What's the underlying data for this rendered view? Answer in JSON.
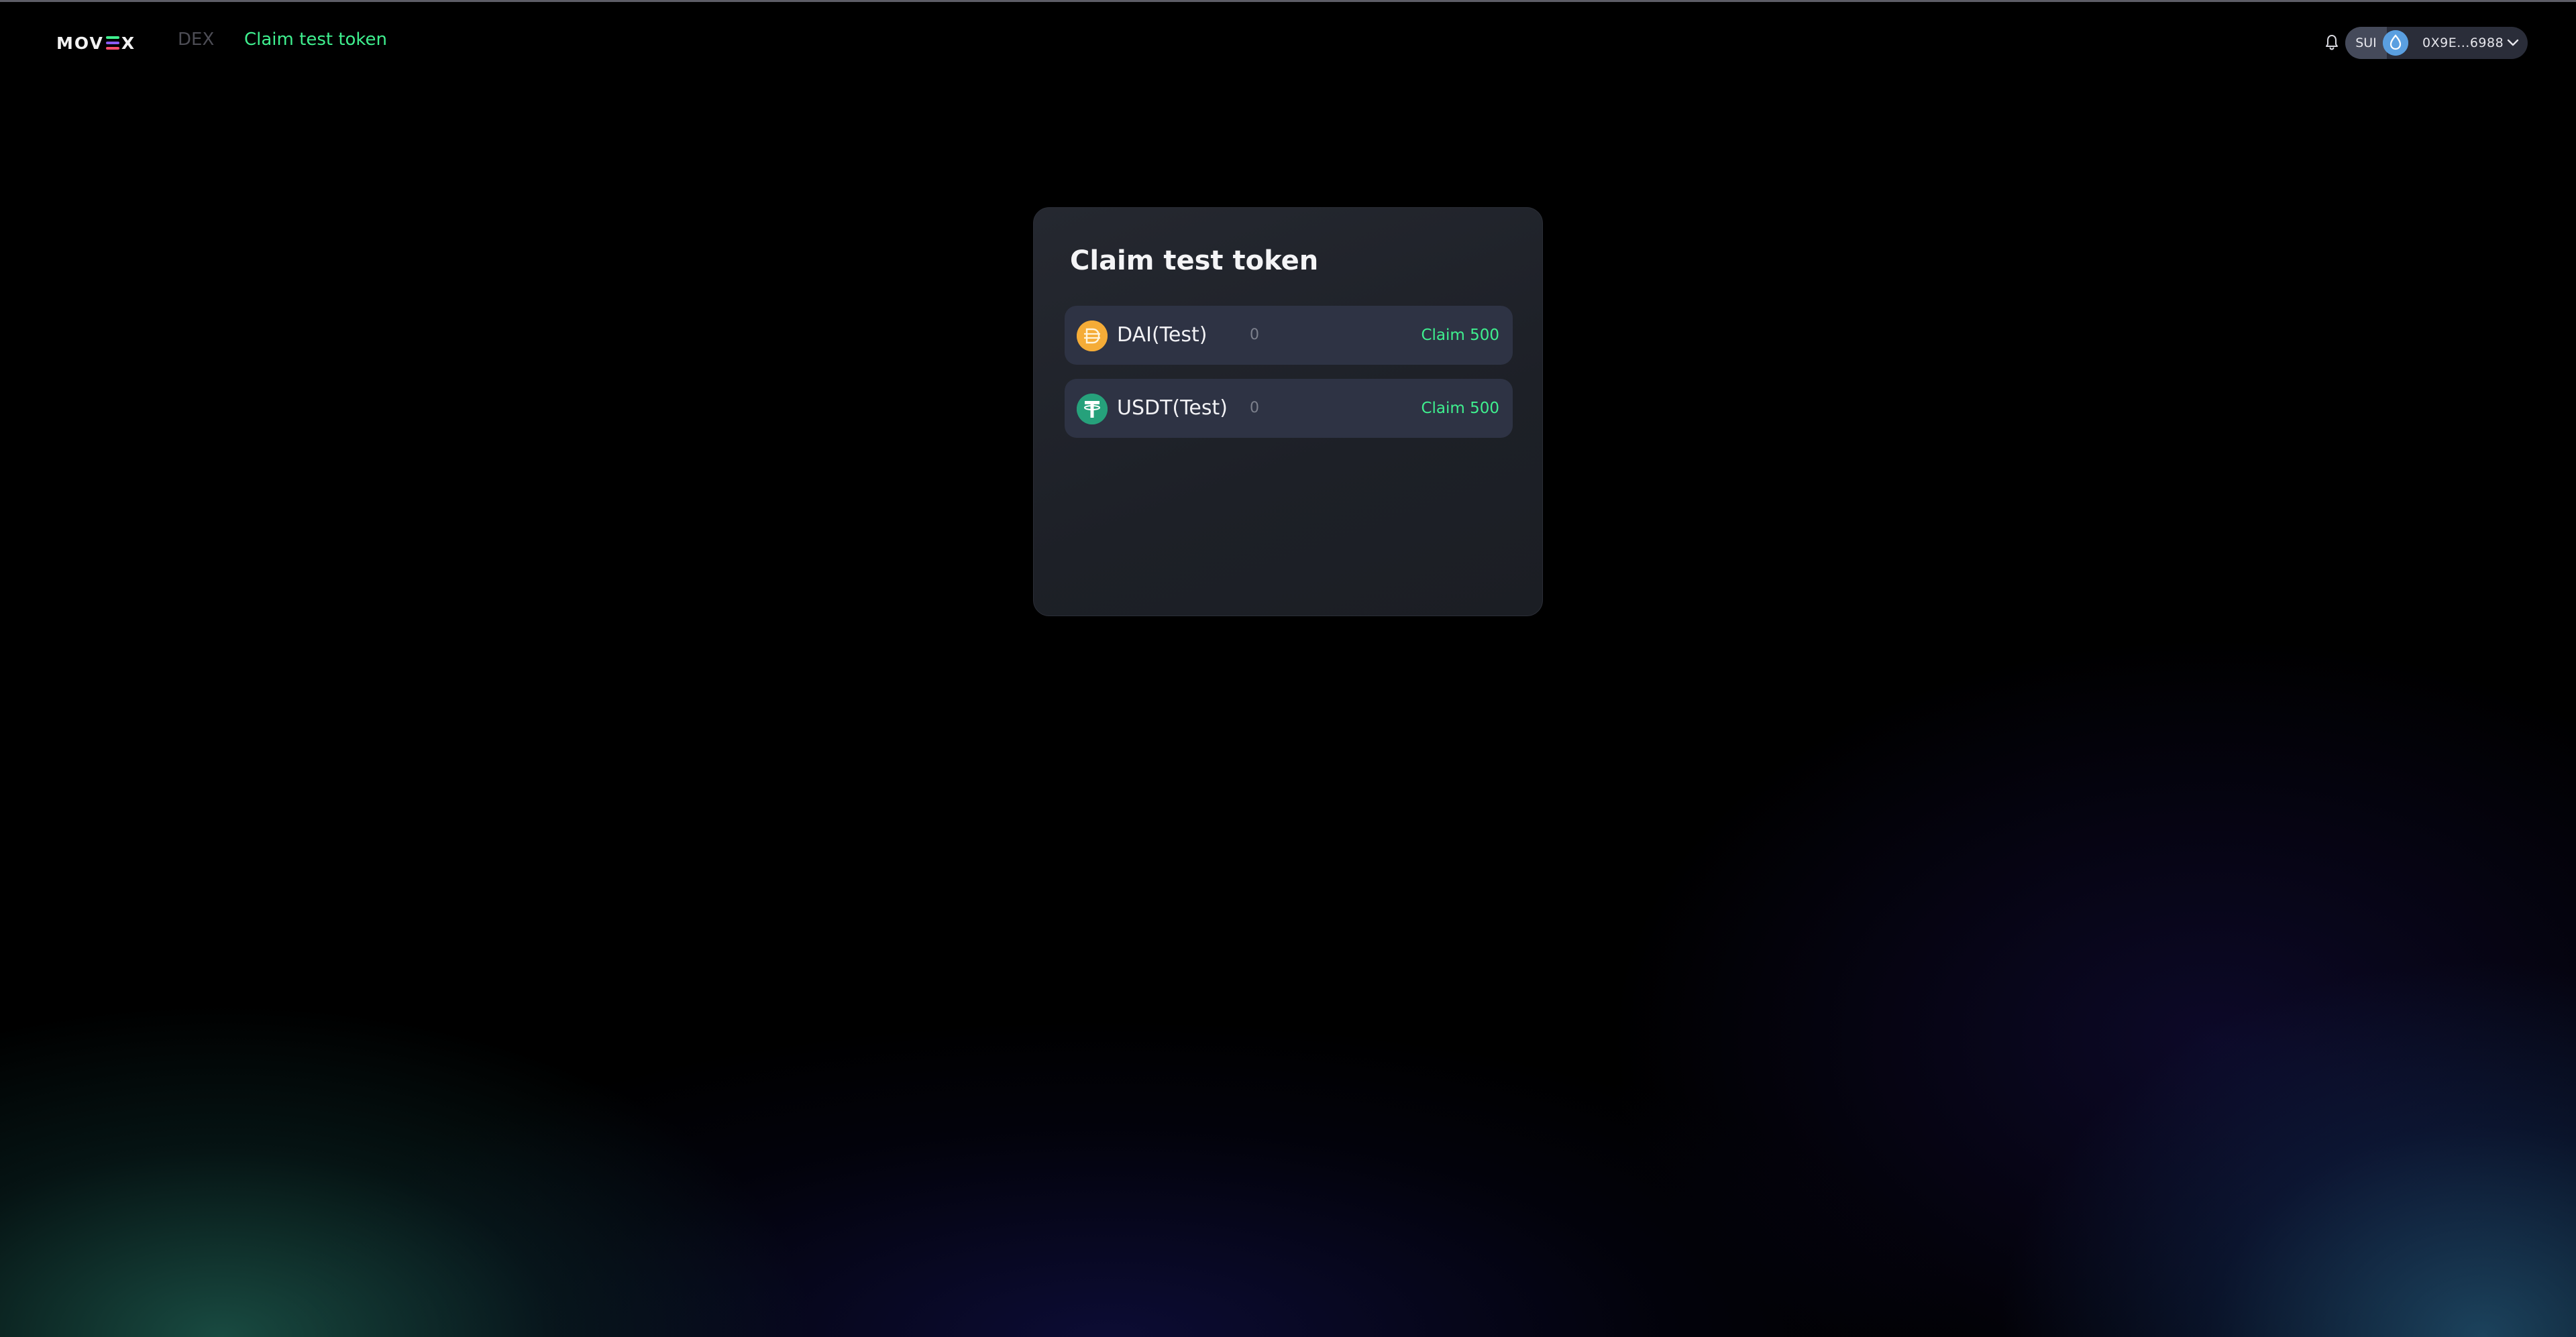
{
  "header": {
    "logo": {
      "prefix": "MOV",
      "suffix": "X"
    },
    "nav": {
      "dex_label": "DEX",
      "claim_label": "Claim test token"
    },
    "notification_icon": "bell-icon",
    "wallet": {
      "network": "SUI",
      "avatar_icon": "sui-drop-icon",
      "address": "0X9E...6988",
      "dropdown_icon": "chevron-down-icon"
    }
  },
  "card": {
    "title": "Claim test token",
    "tokens": [
      {
        "name": "DAI(Test)",
        "balance": "0",
        "claim_label": "Claim 500",
        "icon": "dai-icon",
        "color": "#f5ac37"
      },
      {
        "name": "USDT(Test)",
        "balance": "0",
        "claim_label": "Claim 500",
        "icon": "usdt-icon",
        "color": "#26a17b"
      }
    ]
  },
  "colors": {
    "accent": "#3ff08f",
    "background": "#000000",
    "card": "#1f2229",
    "row": "#2e3344",
    "logo_e": [
      "#3ff08f",
      "#8a5cf6",
      "#ff4d6d"
    ]
  }
}
